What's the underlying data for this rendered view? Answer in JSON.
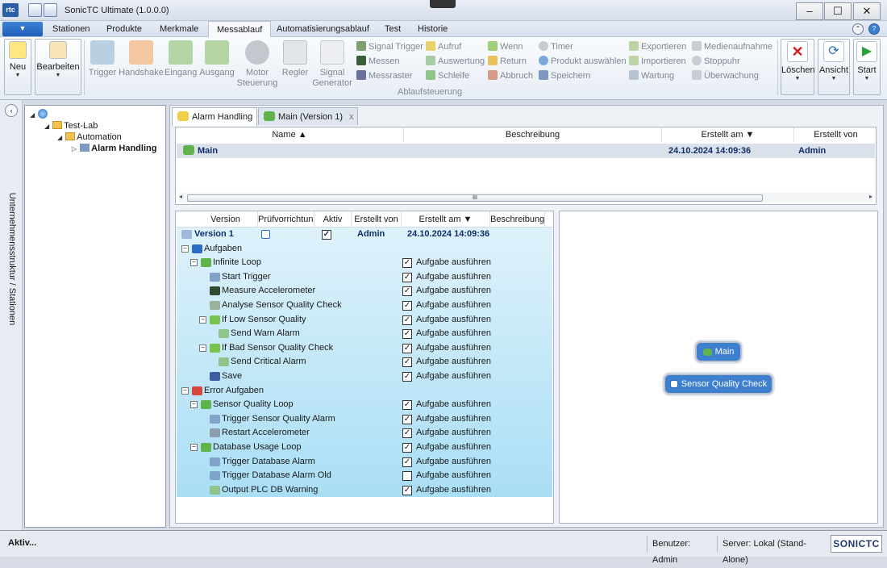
{
  "window": {
    "title": "SonicTC Ultimate (1.0.0.0)",
    "logo": "rtc",
    "controls": [
      "–",
      "☐",
      "✕"
    ]
  },
  "menu": {
    "app_button_glyph": "▼",
    "tabs": [
      "Stationen",
      "Produkte",
      "Merkmale",
      "Messablauf",
      "Automatisierungsablauf",
      "Test",
      "Historie"
    ],
    "selected_tab": "Messablauf"
  },
  "ribbon": {
    "neu": "Neu",
    "bearbeiten": "Bearbeiten",
    "tools": [
      "Trigger",
      "Handshake",
      "Eingang",
      "Ausgang",
      "Motor Steuerung",
      "Regler",
      "Signal Generator"
    ],
    "small_col1": [
      "Signal Trigger",
      "Messen",
      "Messraster"
    ],
    "small_col2": [
      "Aufruf",
      "Auswertung",
      "Schleife"
    ],
    "small_col3": [
      "Wenn",
      "Return",
      "Abbruch"
    ],
    "small_col4": [
      "Timer",
      "Produkt auswählen",
      "Speichern"
    ],
    "small_col5": [
      "Exportieren",
      "Importieren",
      "Wartung"
    ],
    "small_col6": [
      "Medienaufnahme",
      "Stoppuhr",
      "Überwachung"
    ],
    "group_label": "Ablaufsteuerung",
    "loeschen": "Löschen",
    "ansicht": "Ansicht",
    "start": "Start"
  },
  "sidebar": {
    "vertical_label": "Unternehmensstruktur / Stationen",
    "collapse_glyph": "‹",
    "tree": [
      "Test-Lab",
      "Automation",
      "Alarm Handling"
    ]
  },
  "doc_tabs": [
    {
      "label": "Alarm Handling"
    },
    {
      "label": "Main (Version 1)",
      "close": "x"
    }
  ],
  "upper_grid": {
    "headers": [
      "Name ▲",
      "Beschreibung",
      "Erstellt am ▼",
      "Erstellt von"
    ],
    "row": {
      "name": "Main",
      "beschreibung": "",
      "erstellt_am": "24.10.2024 14:09:36",
      "erstellt_von": "Admin"
    },
    "scroll_grip": "III"
  },
  "version_grid": {
    "headers": [
      "Version",
      "Prüfvorrichtung",
      "Aktiv",
      "Erstellt von",
      "Erstellt am ▼",
      "Beschreibung"
    ],
    "version_row": {
      "version": "Version 1",
      "aktiv": true,
      "erstellt_von": "Admin",
      "erstellt_am": "24.10.2024 14:09:36"
    },
    "rows": [
      {
        "label": "Aufgaben",
        "level": 0,
        "expander": "⊟",
        "icon": "tasks-icon",
        "check": null
      },
      {
        "label": "Infinite Loop",
        "level": 1,
        "expander": "⊟",
        "icon": "loop-icon",
        "check": true
      },
      {
        "label": "Start Trigger",
        "level": 2,
        "icon": "trigger-icon",
        "check": true
      },
      {
        "label": "Measure Accelerometer",
        "level": 2,
        "icon": "measure-icon",
        "check": true
      },
      {
        "label": "Analyse Sensor Quality Check",
        "level": 2,
        "icon": "analyse-icon",
        "check": true
      },
      {
        "label": "If Low Sensor Quality",
        "level": 2,
        "expander": "⊟",
        "icon": "if-icon",
        "check": true
      },
      {
        "label": "Send Warn Alarm",
        "level": 3,
        "icon": "output-icon",
        "check": true
      },
      {
        "label": "If Bad Sensor Quality Check",
        "level": 2,
        "expander": "⊟",
        "icon": "if-icon",
        "check": true
      },
      {
        "label": "Send Critical Alarm",
        "level": 3,
        "icon": "output-icon",
        "check": true
      },
      {
        "label": "Save",
        "level": 2,
        "icon": "save-icon",
        "check": true
      },
      {
        "label": "Error Aufgaben",
        "level": 0,
        "expander": "⊟",
        "icon": "error-tasks-icon",
        "check": null
      },
      {
        "label": "Sensor Quality Loop",
        "level": 1,
        "expander": "⊟",
        "icon": "loop-icon",
        "check": true
      },
      {
        "label": "Trigger Sensor Quality Alarm",
        "level": 2,
        "icon": "trigger-icon",
        "check": true
      },
      {
        "label": "Restart Accelerometer",
        "level": 2,
        "icon": "maintenance-icon",
        "check": true
      },
      {
        "label": "Database Usage Loop",
        "level": 1,
        "expander": "⊟",
        "icon": "loop-icon",
        "check": true
      },
      {
        "label": "Trigger Database Alarm",
        "level": 2,
        "icon": "trigger-icon",
        "check": true
      },
      {
        "label": "Trigger Database Alarm Old",
        "level": 2,
        "icon": "trigger-icon",
        "check": false
      },
      {
        "label": "Output PLC DB Warning",
        "level": 2,
        "icon": "output-icon",
        "check": true
      }
    ],
    "check_label": "Aufgabe ausführen"
  },
  "diagram": {
    "nodes": [
      "Main",
      "Sensor Quality Check"
    ]
  },
  "statusbar": {
    "status": "Aktiv...",
    "user": "Benutzer: Admin",
    "server": "Server: Lokal (Stand-Alone)",
    "brand": "SONICTC"
  },
  "colors": {
    "accent": "#2a6ec4",
    "tree_gradient_top": "#dff2fb",
    "tree_gradient_bottom": "#a9def5",
    "node_fill": "#3f7fd0"
  }
}
